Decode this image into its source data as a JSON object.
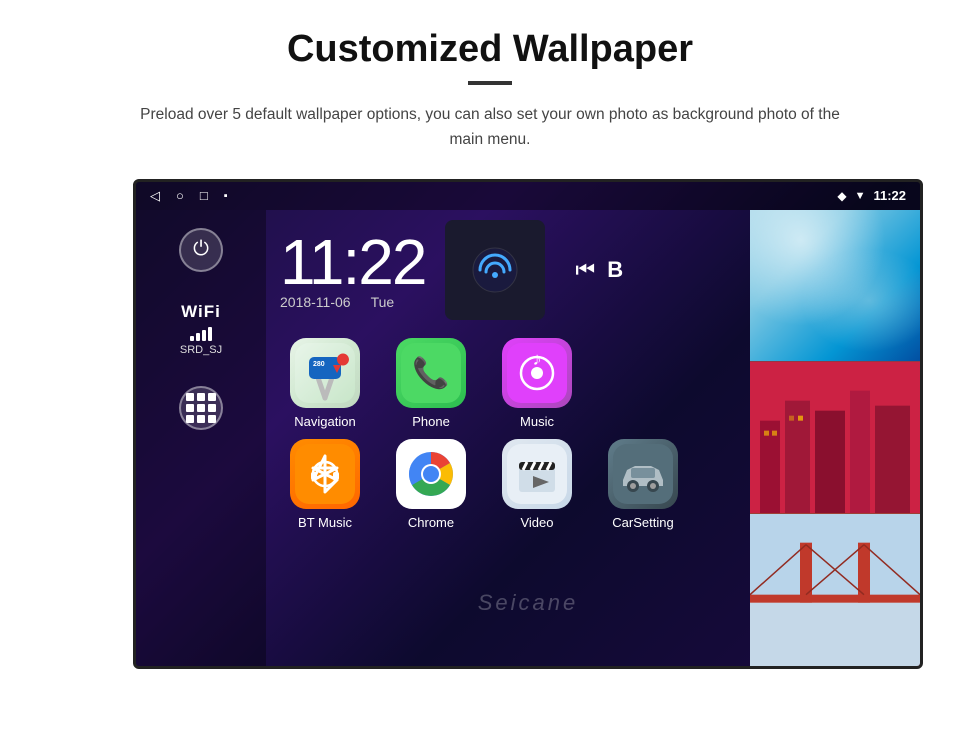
{
  "page": {
    "title": "Customized Wallpaper",
    "description": "Preload over 5 default wallpaper options, you can also set your own photo as background photo of the main menu."
  },
  "device": {
    "status_bar": {
      "time": "11:22",
      "nav_back": "◁",
      "nav_home": "○",
      "nav_recent": "□",
      "nav_screenshot": "⬛",
      "location_icon": "📍",
      "wifi_icon": "▼",
      "time_display": "11:22"
    },
    "clock": {
      "time": "11:22",
      "date": "2018-11-06",
      "day": "Tue"
    },
    "wifi": {
      "label": "WiFi",
      "ssid": "SRD_SJ"
    },
    "apps": [
      {
        "label": "Navigation",
        "icon_type": "navigation"
      },
      {
        "label": "Phone",
        "icon_type": "phone"
      },
      {
        "label": "Music",
        "icon_type": "music"
      },
      {
        "label": "BT Music",
        "icon_type": "bt"
      },
      {
        "label": "Chrome",
        "icon_type": "chrome"
      },
      {
        "label": "Video",
        "icon_type": "video"
      },
      {
        "label": "CarSetting",
        "icon_type": "carsetting"
      }
    ],
    "watermark": "Seicane"
  }
}
